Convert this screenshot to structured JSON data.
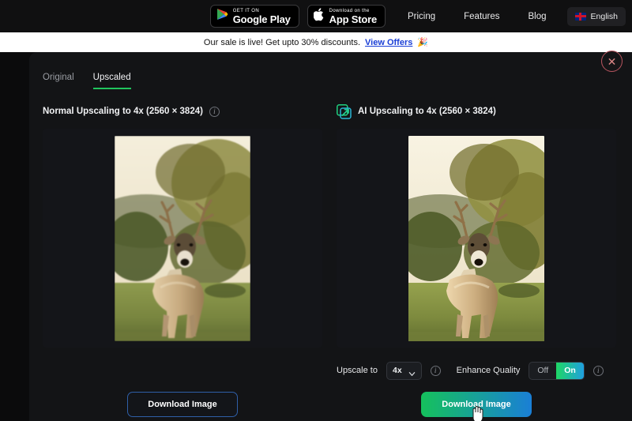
{
  "topnav": {
    "google_play": {
      "small": "GET IT ON",
      "big": "Google Play",
      "icon": "google-play-icon"
    },
    "app_store": {
      "small": "Download on the",
      "big": "App Store",
      "icon": "apple-icon"
    },
    "links": [
      {
        "label": "Pricing"
      },
      {
        "label": "Features"
      },
      {
        "label": "Blog"
      }
    ],
    "language": {
      "label": "English",
      "flag": "uk-flag-icon"
    }
  },
  "banner": {
    "text": "Our sale is live! Get upto 30% discounts.",
    "link": "View Offers",
    "emoji": "🎉"
  },
  "modal": {
    "close_label": "✕",
    "tabs": [
      {
        "label": "Original",
        "active": false
      },
      {
        "label": "Upscaled",
        "active": true
      }
    ],
    "left_panel": {
      "title": "Normal Upscaling to 4x (2560 × 3824)",
      "info_icon": "info-icon",
      "image_alt": "deer-standing-in-golden-field",
      "download_label": "Download Image"
    },
    "right_panel": {
      "icon": "ai-expand-icon",
      "title": "AI Upscaling to 4x (2560 × 3824)",
      "image_alt": "deer-standing-in-golden-field-upscaled",
      "controls": {
        "upscale_label": "Upscale to",
        "upscale_value": "4x",
        "upscale_info_icon": "info-icon",
        "enhance_label": "Enhance Quality",
        "enhance_off": "Off",
        "enhance_on": "On",
        "enhance_selected": "On",
        "enhance_info_icon": "info-icon"
      },
      "download_label": "Download Image"
    }
  },
  "colors": {
    "accent_green": "#21c55d",
    "accent_blue": "#1a7fd6",
    "banner_bg": "#ffffff",
    "banner_link": "#1a3fd6",
    "close_border": "#b8555f",
    "modal_bg": "#131416",
    "panel_bg": "#141519"
  }
}
